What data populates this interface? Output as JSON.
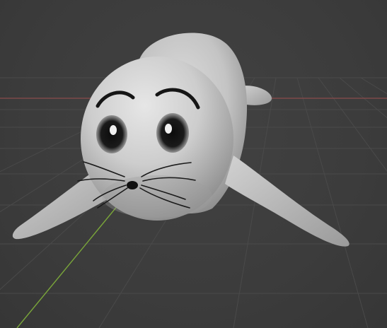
{
  "viewport": {
    "mode": "3d-viewport-solid-shading",
    "object": "seal",
    "background_color": "#3d3d3d",
    "grid_color": "#4a4a4a",
    "x_axis_color": "#8a4b4b",
    "y_axis_color": "#7aa63a",
    "model_color": "#c8c8c8",
    "icons": [
      "seal-model"
    ]
  }
}
